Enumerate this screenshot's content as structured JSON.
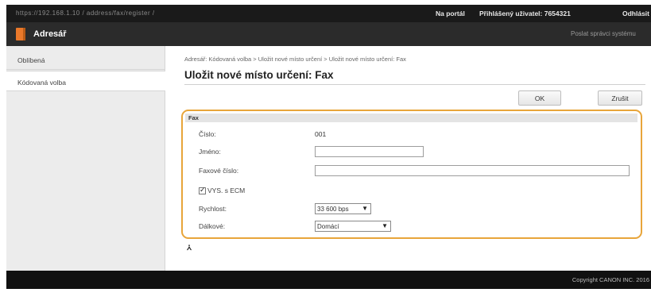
{
  "topbar": {
    "url_text": "https://192.168.1.10 / address/fax/register /",
    "portal_link": "Na portál",
    "login_user": "Přihlášený uživatel: 7654321",
    "logout_link": "Odhlásit"
  },
  "app": {
    "title": "Adresář",
    "admin_mail": "Poslat správci systému"
  },
  "sidebar": {
    "items": [
      {
        "label": "Oblíbená"
      },
      {
        "label": "Kódovaná volba"
      }
    ]
  },
  "page": {
    "breadcrumb": "Adresář: Kódovaná volba > Uložit nové místo určení > Uložit nové místo určení: Fax",
    "title": "Uložit nové místo určení: Fax",
    "ok_label": "OK",
    "cancel_label": "Zrušit"
  },
  "fax_form": {
    "section_title": "Fax",
    "number_label": "Číslo:",
    "number_value": "001",
    "name_label": "Jméno:",
    "name_value": "",
    "fax_number_label": "Faxové číslo:",
    "fax_number_value": "",
    "ecm_label": "VYS. s ECM",
    "ecm_checked": true,
    "speed_label": "Rychlost:",
    "speed_value": "33 600 bps",
    "distance_label": "Dálkové:",
    "distance_value": "Domácí"
  },
  "back_to_top_icon": "double-arrow-up-icon",
  "footer": {
    "copyright": "Copyright CANON INC. 2016"
  },
  "colors": {
    "highlight_border": "#e8a53a",
    "header_bg": "#2b2b2b",
    "brand_icon": "#e9782a"
  }
}
